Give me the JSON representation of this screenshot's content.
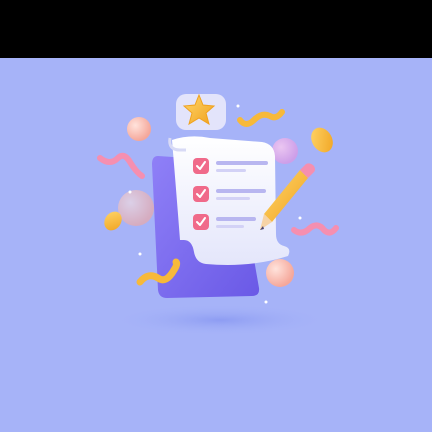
{
  "illustration": {
    "subject": "checklist-clipboard-with-pencil",
    "items": [
      {
        "icon": "checkmark-icon",
        "checked": true
      },
      {
        "icon": "checkmark-icon",
        "checked": true
      },
      {
        "icon": "checkmark-icon",
        "checked": true
      }
    ],
    "decorations": [
      "star-icon",
      "pencil-icon",
      "coin-icon",
      "coin-icon",
      "sphere",
      "sphere",
      "sphere",
      "squiggle",
      "squiggle",
      "squiggle",
      "squiggle"
    ]
  },
  "colors": {
    "background": "#a6b3f8",
    "top_band": "#000000",
    "clipboard": "#7b6cf0",
    "paper": "#f4f5ff",
    "check_box": "#f06a8a",
    "line": "#b8b6f0",
    "pencil": "#f5b531",
    "pink": "#f58fb0",
    "gold": "#f7b93a"
  }
}
